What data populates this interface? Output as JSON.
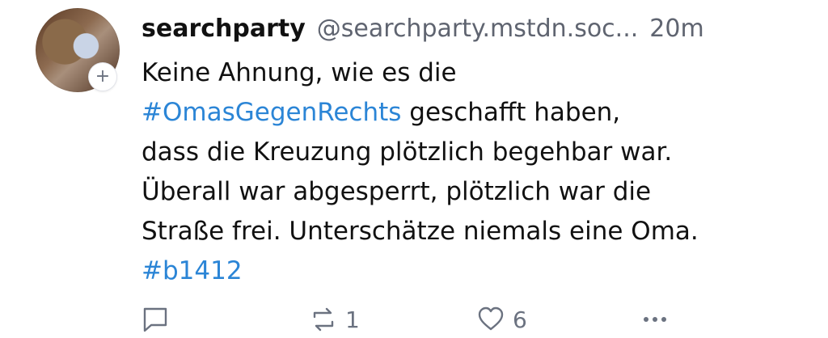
{
  "post": {
    "display_name": "searchparty",
    "handle": "@searchparty.mstdn.soc...",
    "time": "20m",
    "follow_symbol": "+",
    "content": {
      "line1": "Keine Ahnung, wie es die",
      "hashtag1": "#OmasGegenRechts",
      "line2_rest": " geschafft haben,",
      "line3": "dass die Kreuzung plötzlich begehbar war.",
      "line4": "Überall war abgesperrt, plötzlich war die",
      "line5": "Straße frei. Unterschätze niemals eine Oma.",
      "hashtag2": "#b1412"
    },
    "actions": {
      "reblog_count": "1",
      "favourite_count": "6"
    }
  },
  "colors": {
    "link": "#2b85d6",
    "secondary_text": "#5f6470",
    "icon": "#6b7280"
  },
  "icons": [
    "plus-icon",
    "reply-icon",
    "reblog-icon",
    "heart-icon",
    "more-icon"
  ]
}
